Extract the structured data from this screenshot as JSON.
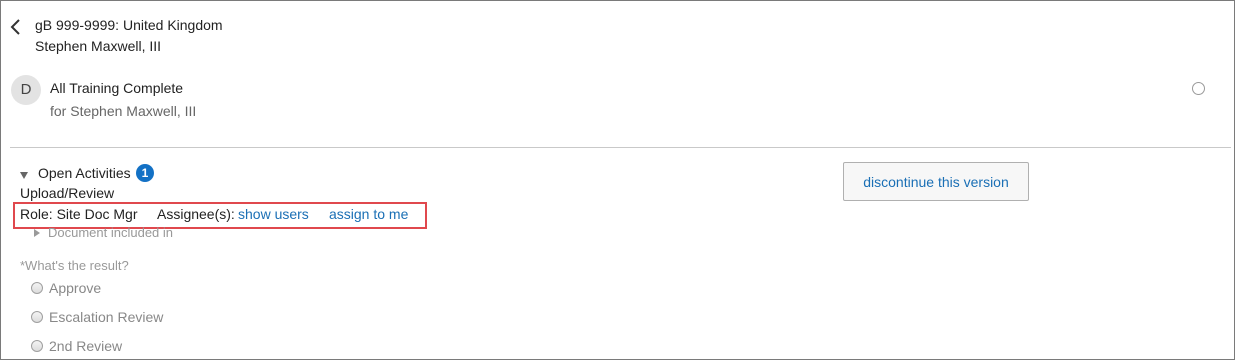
{
  "header": {
    "document_line": "gB 999-9999: United Kingdom",
    "person_line": "Stephen Maxwell, III"
  },
  "task": {
    "avatar_letter": "D",
    "title": "All Training Complete",
    "subtitle": "for Stephen Maxwell, III"
  },
  "open_activities": {
    "label": "Open Activities",
    "count": "1",
    "activity_name": "Upload/Review",
    "role_text": "Role: Site Doc Mgr",
    "assignee_label": "Assignee(s):",
    "show_users_link": "show users",
    "assign_to_me_link": "assign to me",
    "document_included_label": "Document included in"
  },
  "result": {
    "question": "*What's the result?",
    "options": [
      "Approve",
      "Escalation Review",
      "2nd Review"
    ]
  },
  "actions": {
    "discontinue_label": "discontinue this version"
  },
  "colors": {
    "link": "#1a6fb5",
    "badge": "#1371c5",
    "highlight": "#e0484d"
  },
  "icons": {
    "back": "chevron-left-icon",
    "expand": "caret-down-icon",
    "collapse": "caret-right-icon"
  }
}
